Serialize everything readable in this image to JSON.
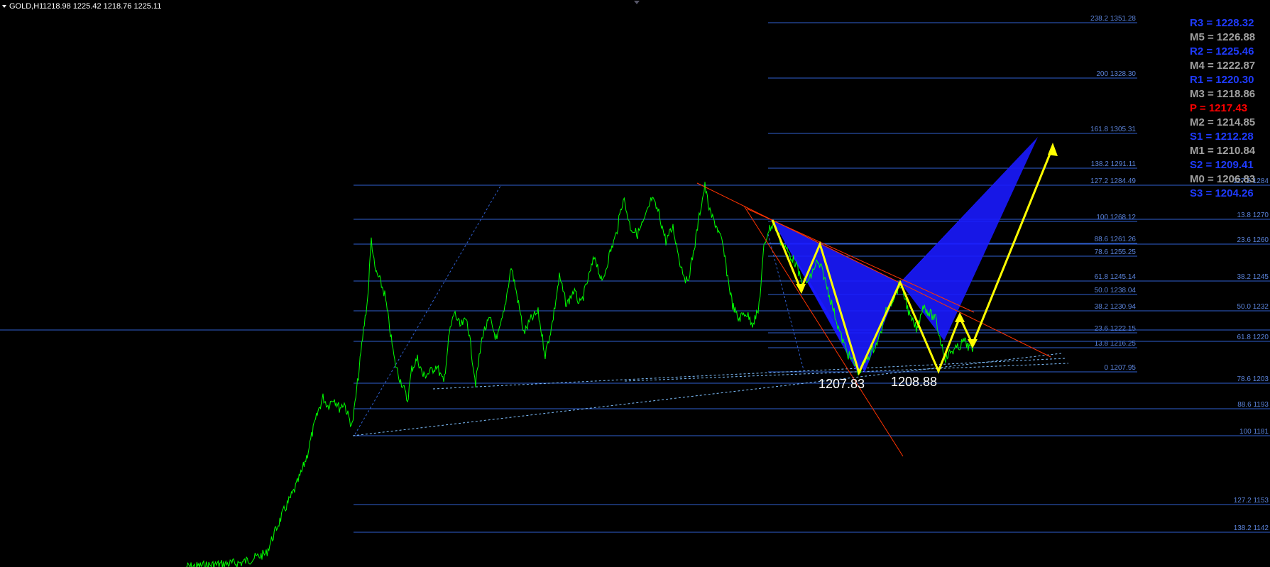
{
  "header": {
    "symbol": "GOLD,H1",
    "ohlc": "1218.98 1225.42 1218.76 1225.11"
  },
  "colors": {
    "background": "#000000",
    "price": "#00ff00",
    "level_line": "#2f5fd0",
    "pattern_fill": "#1a1aff",
    "zigzag": "#ffff00",
    "trendline": "#ff3300",
    "pivot_blue": "#1f3bff",
    "pivot_gray": "#a0a0a0",
    "pivot_red": "#ff0000"
  },
  "chart_data": {
    "type": "line",
    "series": [
      {
        "name": "",
        "values": []
      }
    ],
    "fib_levels_inner": [
      {
        "label": "238.2 1351.28",
        "price": 1351.28
      },
      {
        "label": "200 1328.30",
        "price": 1328.3
      },
      {
        "label": "161.8 1305.31",
        "price": 1305.31
      },
      {
        "label": "138.2 1291.11",
        "price": 1291.11
      },
      {
        "label": "127.2 1284.49",
        "price": 1284.49
      },
      {
        "label": "100 1268.12",
        "price": 1268.12
      },
      {
        "label": "88.6 1261.26",
        "price": 1261.26
      },
      {
        "label": "78.6 1255.25",
        "price": 1255.25
      },
      {
        "label": "61.8 1245.14",
        "price": 1245.14
      },
      {
        "label": "50.0 1238.04",
        "price": 1238.04
      },
      {
        "label": "38.2 1230.94",
        "price": 1230.94
      },
      {
        "label": "23.6 1222.15",
        "price": 1222.15
      },
      {
        "label": "13.8 1216.25",
        "price": 1216.25
      },
      {
        "label": "0 1207.95",
        "price": 1207.95
      }
    ],
    "fib_levels_outer": [
      {
        "label": "127.2 1284",
        "price": 1284
      },
      {
        "label": "13.8 1270",
        "price": 1270
      },
      {
        "label": "23.6 1260",
        "price": 1260
      },
      {
        "label": "38.2 1245",
        "price": 1245
      },
      {
        "label": "50.0 1232",
        "price": 1232
      },
      {
        "label": "61.8 1220",
        "price": 1220
      },
      {
        "label": "78.6 1203",
        "price": 1203
      },
      {
        "label": "88.6 1193",
        "price": 1193
      },
      {
        "label": "100 1181",
        "price": 1181
      },
      {
        "label": "127.2 1153",
        "price": 1153
      },
      {
        "label": "138.2 1142",
        "price": 1142
      }
    ],
    "pivots": [
      {
        "label": "R3 = 1228.32",
        "color": "#1f3bff"
      },
      {
        "label": "M5 = 1226.88",
        "color": "#a0a0a0"
      },
      {
        "label": "R2 = 1225.46",
        "color": "#1f3bff"
      },
      {
        "label": "M4 = 1222.87",
        "color": "#a0a0a0"
      },
      {
        "label": "R1 = 1220.30",
        "color": "#1f3bff"
      },
      {
        "label": "M3 = 1218.86",
        "color": "#a0a0a0"
      },
      {
        "label": "P  = 1217.43",
        "color": "#ff0000"
      },
      {
        "label": "M2 = 1214.85",
        "color": "#a0a0a0"
      },
      {
        "label": "S1 = 1212.28",
        "color": "#1f3bff"
      },
      {
        "label": "M1 = 1210.84",
        "color": "#a0a0a0"
      },
      {
        "label": "S2 = 1209.41",
        "color": "#1f3bff"
      },
      {
        "label": "M0 = 1206.83",
        "color": "#a0a0a0"
      },
      {
        "label": "S3 = 1204.26",
        "color": "#1f3bff"
      }
    ],
    "annotations": [
      "1207.83",
      "1208.88"
    ]
  }
}
